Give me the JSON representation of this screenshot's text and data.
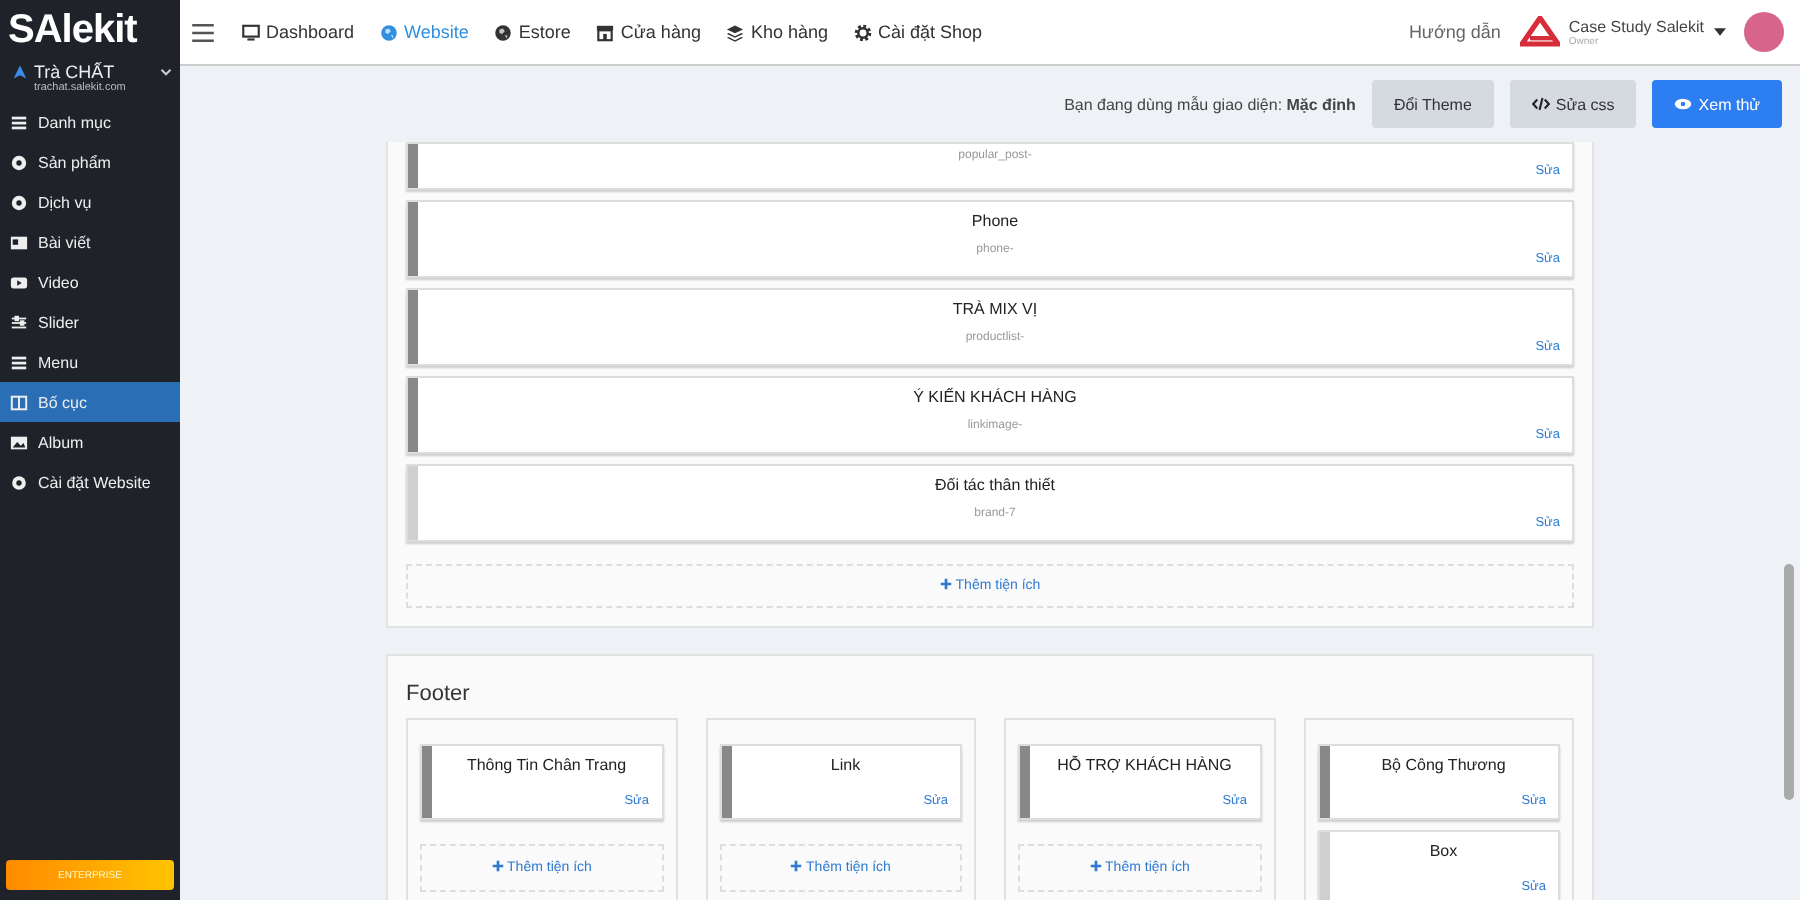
{
  "sidebar": {
    "logo": "SAlekit",
    "store": {
      "name": "Trà CHẤT",
      "domain": "trachat.salekit.com"
    },
    "items": [
      {
        "label": "Danh mục",
        "selected": false
      },
      {
        "label": "Sản phẩm",
        "selected": false
      },
      {
        "label": "Dịch vụ",
        "selected": false
      },
      {
        "label": "Bài viết",
        "selected": false
      },
      {
        "label": "Video",
        "selected": false
      },
      {
        "label": "Slider",
        "selected": false
      },
      {
        "label": "Menu",
        "selected": false
      },
      {
        "label": "Bố cục",
        "selected": true
      },
      {
        "label": "Album",
        "selected": false
      },
      {
        "label": "Cài đặt Website",
        "selected": false
      }
    ],
    "plan_button": "ENTERPRISE"
  },
  "topnav": {
    "items": [
      {
        "label": "Dashboard",
        "selected": false
      },
      {
        "label": "Website",
        "selected": true
      },
      {
        "label": "Estore",
        "selected": false
      },
      {
        "label": "Cửa hàng",
        "selected": false
      },
      {
        "label": "Kho hàng",
        "selected": false
      },
      {
        "label": "Cài đặt Shop",
        "selected": false
      }
    ],
    "help": "Hướng dẫn",
    "account": {
      "name": "Case Study Salekit",
      "role": "Owner"
    }
  },
  "theme_bar": {
    "text": "Bạn đang dùng mẫu giao diện: **Mặc định**",
    "buttons": [
      {
        "label": "Đổi Theme",
        "kind": "plain"
      },
      {
        "label": "Sửa css",
        "kind": "code"
      },
      {
        "label": "Xem thử",
        "kind": "primary"
      }
    ]
  },
  "body_widgets": {
    "items": [
      {
        "subtitle": "popular_post-",
        "edit": "Sửa",
        "active": true
      },
      {
        "title": "Phone",
        "subtitle": "phone-",
        "edit": "Sửa",
        "active": true
      },
      {
        "title": "TRÀ MIX VỊ",
        "subtitle": "productlist-",
        "edit": "Sửa",
        "active": true
      },
      {
        "title": "Ý KIẾN KHÁCH HÀNG",
        "subtitle": "linkimage-",
        "edit": "Sửa",
        "active": true
      },
      {
        "title": "Đối tác thân thiết",
        "subtitle": "brand-7",
        "edit": "Sửa",
        "active": false
      }
    ],
    "add": "Thêm tiện ích"
  },
  "footer": {
    "title": "Footer",
    "columns": [
      {
        "widgets": [
          {
            "title": "Thông Tin Chân Trang",
            "edit": "Sửa",
            "active": true
          }
        ],
        "add": "Thêm tiện ích"
      },
      {
        "widgets": [
          {
            "title": "Link",
            "edit": "Sửa",
            "active": true
          }
        ],
        "add": "Thêm tiện ích"
      },
      {
        "widgets": [
          {
            "title": "HỖ TRỢ KHÁCH HÀNG",
            "edit": "Sửa",
            "active": true
          }
        ],
        "add": "Thêm tiện ích"
      },
      {
        "widgets": [
          {
            "title": "Bộ Công Thương",
            "edit": "Sửa",
            "active": true
          },
          {
            "title": "Box",
            "edit": "Sửa",
            "active": false
          }
        ]
      }
    ]
  }
}
